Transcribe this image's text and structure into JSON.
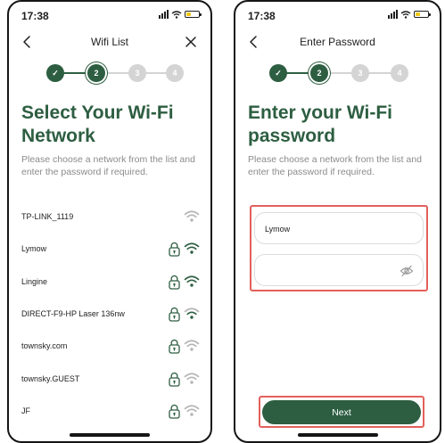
{
  "status_bar": {
    "time": "17:38"
  },
  "colors": {
    "brand_green": "#2d5e41",
    "inactive_step": "#d4d4d4",
    "wifi_strong": "#2d5e41",
    "wifi_weak": "#b4b4b4",
    "highlight": "#e2605c",
    "battery": "#f0c514"
  },
  "wifi_list_screen": {
    "nav_title": "Wifi List",
    "stepper": [
      {
        "label": "✓",
        "state": "done"
      },
      {
        "label": "2",
        "state": "active"
      },
      {
        "label": "3",
        "state": "inactive"
      },
      {
        "label": "4",
        "state": "inactive"
      }
    ],
    "headline_line1": "Select Your Wi-Fi",
    "headline_line2": "Network",
    "subtext_line1": "Please choose a network from the list and",
    "subtext_line2": "enter the password if required.",
    "networks": [
      {
        "name": "TP-LINK_1119",
        "locked": false,
        "signal": "weak"
      },
      {
        "name": "Lymow",
        "locked": true,
        "signal": "strong"
      },
      {
        "name": "Lingine",
        "locked": true,
        "signal": "strong"
      },
      {
        "name": "DIRECT-F9-HP Laser 136nw",
        "locked": true,
        "signal": "medium"
      },
      {
        "name": "townsky.com",
        "locked": true,
        "signal": "weak"
      },
      {
        "name": "townsky.GUEST",
        "locked": true,
        "signal": "weak"
      },
      {
        "name": "JF",
        "locked": true,
        "signal": "weak"
      }
    ]
  },
  "password_screen": {
    "nav_title": "Enter Password",
    "stepper": [
      {
        "label": "✓",
        "state": "done"
      },
      {
        "label": "2",
        "state": "active"
      },
      {
        "label": "3",
        "state": "inactive"
      },
      {
        "label": "4",
        "state": "inactive"
      }
    ],
    "headline_line1": "Enter your Wi-Fi",
    "headline_line2": "password",
    "subtext_line1": "Please choose a network from the list and",
    "subtext_line2": "enter the password if required.",
    "ssid_value": "Lymow",
    "password_value": "",
    "next_label": "Next"
  }
}
